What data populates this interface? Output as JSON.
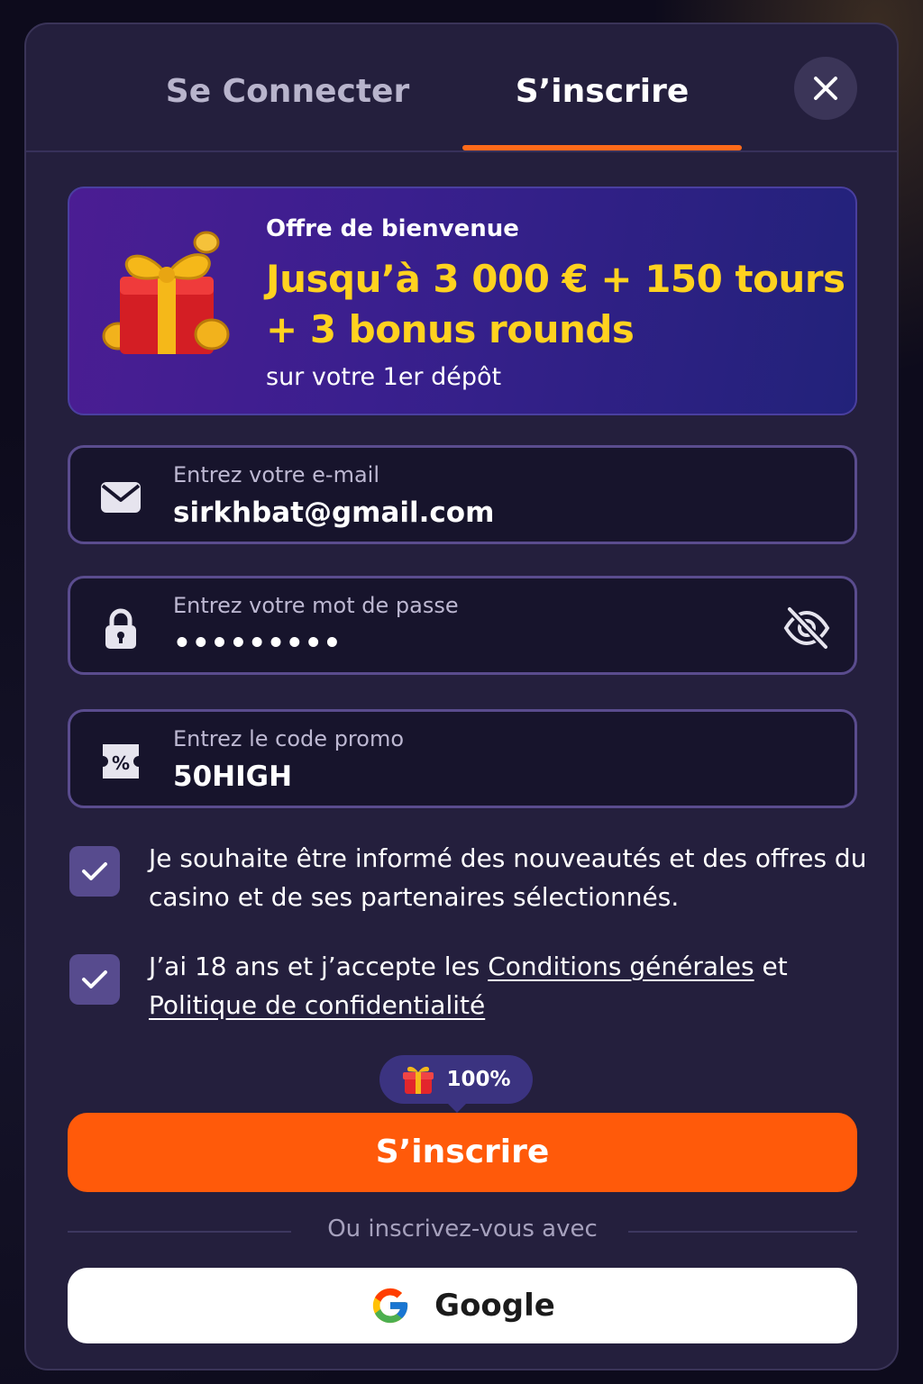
{
  "tabs": {
    "login_label": "Se Connecter",
    "signup_label": "S’inscrire",
    "active": "signup"
  },
  "offer": {
    "title": "Offre de bienvenue",
    "headline_line1": "Jusqu’à 3 000 € + 150 tours",
    "headline_line2": "+ 3 bonus rounds",
    "subtitle": "sur votre 1er dépôt",
    "icon": "gift-icon"
  },
  "form": {
    "email": {
      "label": "Entrez votre e-mail",
      "value": "sirkhbat@gmail.com",
      "icon": "mail-icon"
    },
    "password": {
      "label": "Entrez votre mot de passe",
      "value": "•••••••••",
      "icon": "lock-icon",
      "toggle_icon": "eye-off-icon"
    },
    "promo": {
      "label": "Entrez le code promo",
      "value": "50HIGH",
      "icon": "percent-icon"
    }
  },
  "consents": {
    "newsletter": {
      "checked": true,
      "text": "Je souhaite être informé des nouveautés et des offres du casino et de ses partenaires sélectionnés."
    },
    "terms": {
      "checked": true,
      "prefix": "J’ai 18 ans et j’accepte les ",
      "link1": "Conditions générales",
      "middle": " et ",
      "link2": "Politique de confidentialité"
    }
  },
  "bonus_pill": {
    "label": "100%",
    "icon": "gift-icon"
  },
  "submit_label": "S’inscrire",
  "divider_text": "Ou inscrivez-vous avec",
  "google": {
    "label": "Google",
    "icon": "google-icon"
  },
  "colors": {
    "accent": "#ff5a0a",
    "highlight": "#ffd21f",
    "modal_bg": "#241f3d",
    "checkbox": "#574b8e"
  }
}
